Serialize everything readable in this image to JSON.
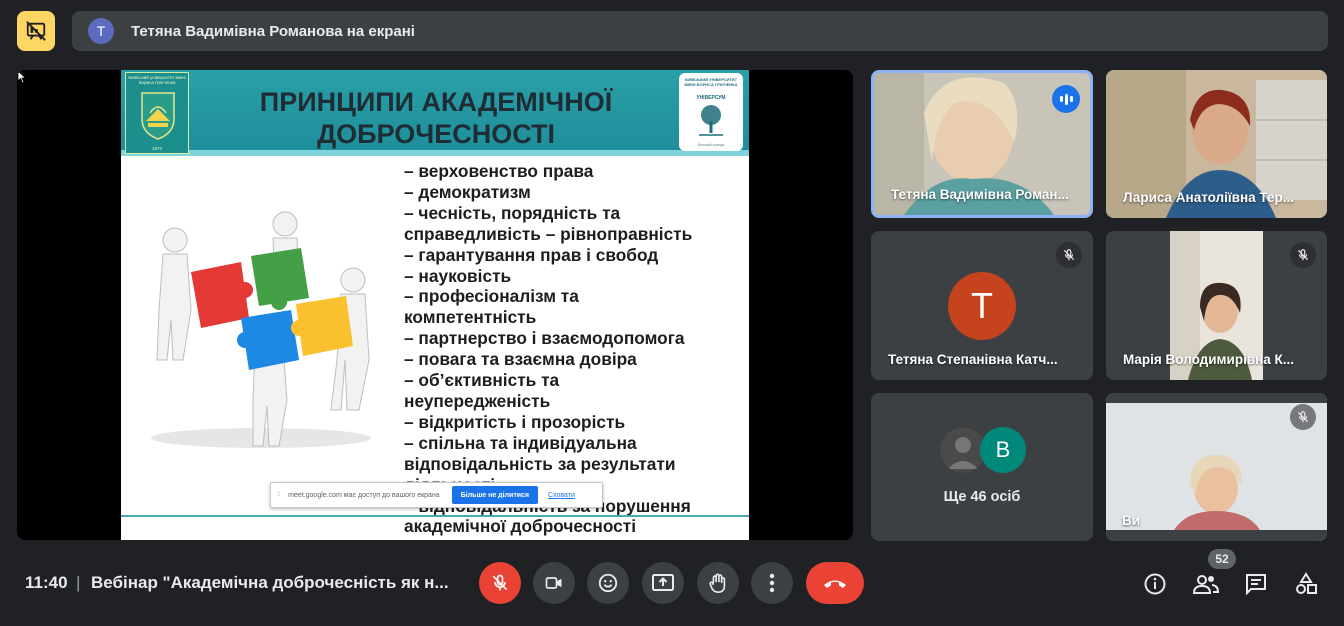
{
  "top": {
    "present_icon": "presentation-stop-icon",
    "banner_avatar_letter": "T",
    "banner_text": "Тетяна Вадимівна Романова на екрані"
  },
  "slide": {
    "title_line1": "ПРИНЦИПИ АКАДЕМІЧНОЇ",
    "title_line2": "ДОБРОЧЕСНОСТІ",
    "logo_left_text": "Київський університет імені Бориса Грінченка",
    "logo_left_year": "1874",
    "logo_right_text": "КИЇВСЬКИЙ УНІВЕРСИТЕТ ІМЕНІ БОРИСА ГРІНЧЕНКА",
    "logo_right_brand": "УНІВЕРСУМ",
    "logo_right_sub": "Фаховий коледж",
    "principles": [
      "– верховенство права",
      "– демократизм",
      "– чесність, порядність та",
      "справедливість – рівноправність",
      "– гарантування прав і свобод",
      "– науковість",
      "– професіоналізм та",
      "компетентність",
      "– партнерство і взаємодопомога",
      "– повага та взаємна довіра",
      "– об’єктивність та",
      "неупередженість",
      "– відкритість і прозорість",
      "– спільна та індивідуальна",
      "відповідальність за результати",
      "діяльності",
      "– відповідальність за порушення",
      "академічної доброчесності"
    ]
  },
  "share_bar": {
    "text": "meet.google.com має доступ до вашого екрана",
    "stop_label": "Більше не ділитися",
    "hide_label": "Сховати"
  },
  "participants": [
    {
      "name": "Тетяна Вадимівна Роман...",
      "state": "speaking"
    },
    {
      "name": "Лариса Анатоліївна Тер...",
      "state": "video"
    },
    {
      "name": "Тетяна Степанівна Катч...",
      "state": "muted",
      "avatar_letter": "T",
      "avatar_color": "#c5441d"
    },
    {
      "name": "Марія Володимирівна К...",
      "state": "muted"
    },
    {
      "name": "Ще 46 осіб",
      "state": "group",
      "avatar_letter": "B",
      "avatar_color": "#00897b"
    },
    {
      "name": "Ви",
      "state": "muted"
    }
  ],
  "bottom": {
    "time": "11:40",
    "separator": "|",
    "meeting_title": "Вебінар \"Академічна доброчесність як н...",
    "people_count": "52"
  },
  "controls": [
    "mic-off-icon",
    "camera-icon",
    "emoji-icon",
    "present-icon",
    "raise-hand-icon",
    "more-options-icon",
    "end-call-icon"
  ],
  "right_icons": [
    "info-icon",
    "people-icon",
    "chat-icon",
    "activities-icon"
  ],
  "colors": {
    "background": "#202124",
    "tile": "#3c4043",
    "accent_blue": "#8ab4f8",
    "red": "#ea4335",
    "present_yellow": "#fdd663"
  }
}
